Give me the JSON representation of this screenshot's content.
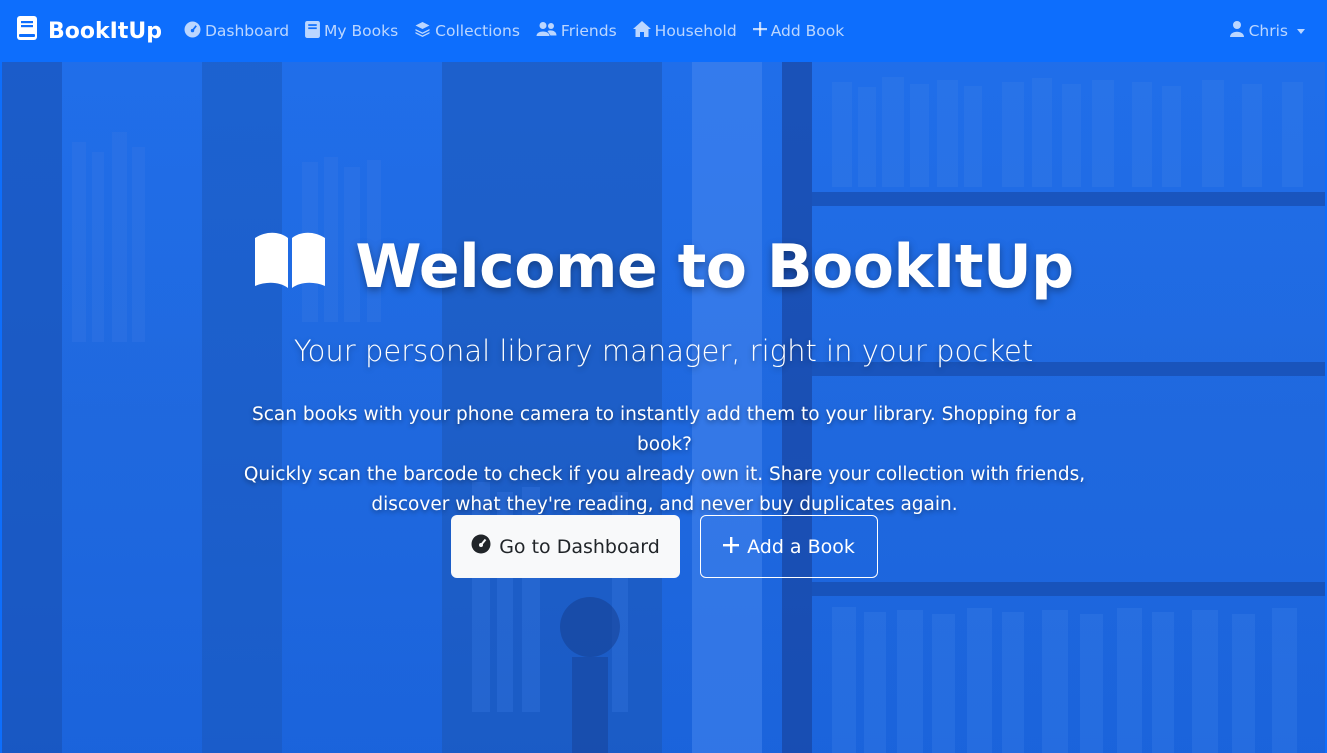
{
  "brand": {
    "name": "BookItUp",
    "icon": "book-icon"
  },
  "nav": {
    "dashboard": "Dashboard",
    "my_books": "My Books",
    "collections": "Collections",
    "friends": "Friends",
    "household": "Household",
    "add_book": "Add Book"
  },
  "user": {
    "name": "Chris"
  },
  "hero": {
    "title": "Welcome to BookItUp",
    "subtitle": "Your personal library manager, right in your pocket",
    "description_lines": [
      "Scan books with your phone camera to instantly add them to your library. Shopping for a book?",
      "Quickly scan the barcode to check if you already own it. Share your collection with friends,",
      "discover what they're reading, and never buy duplicates again."
    ],
    "primary_button": "Go to Dashboard",
    "secondary_button": "Add a Book"
  },
  "colors": {
    "navbar": "#0d6efd",
    "hero_overlay": "#1d6ce8",
    "button_light": "#f8f9fa"
  }
}
